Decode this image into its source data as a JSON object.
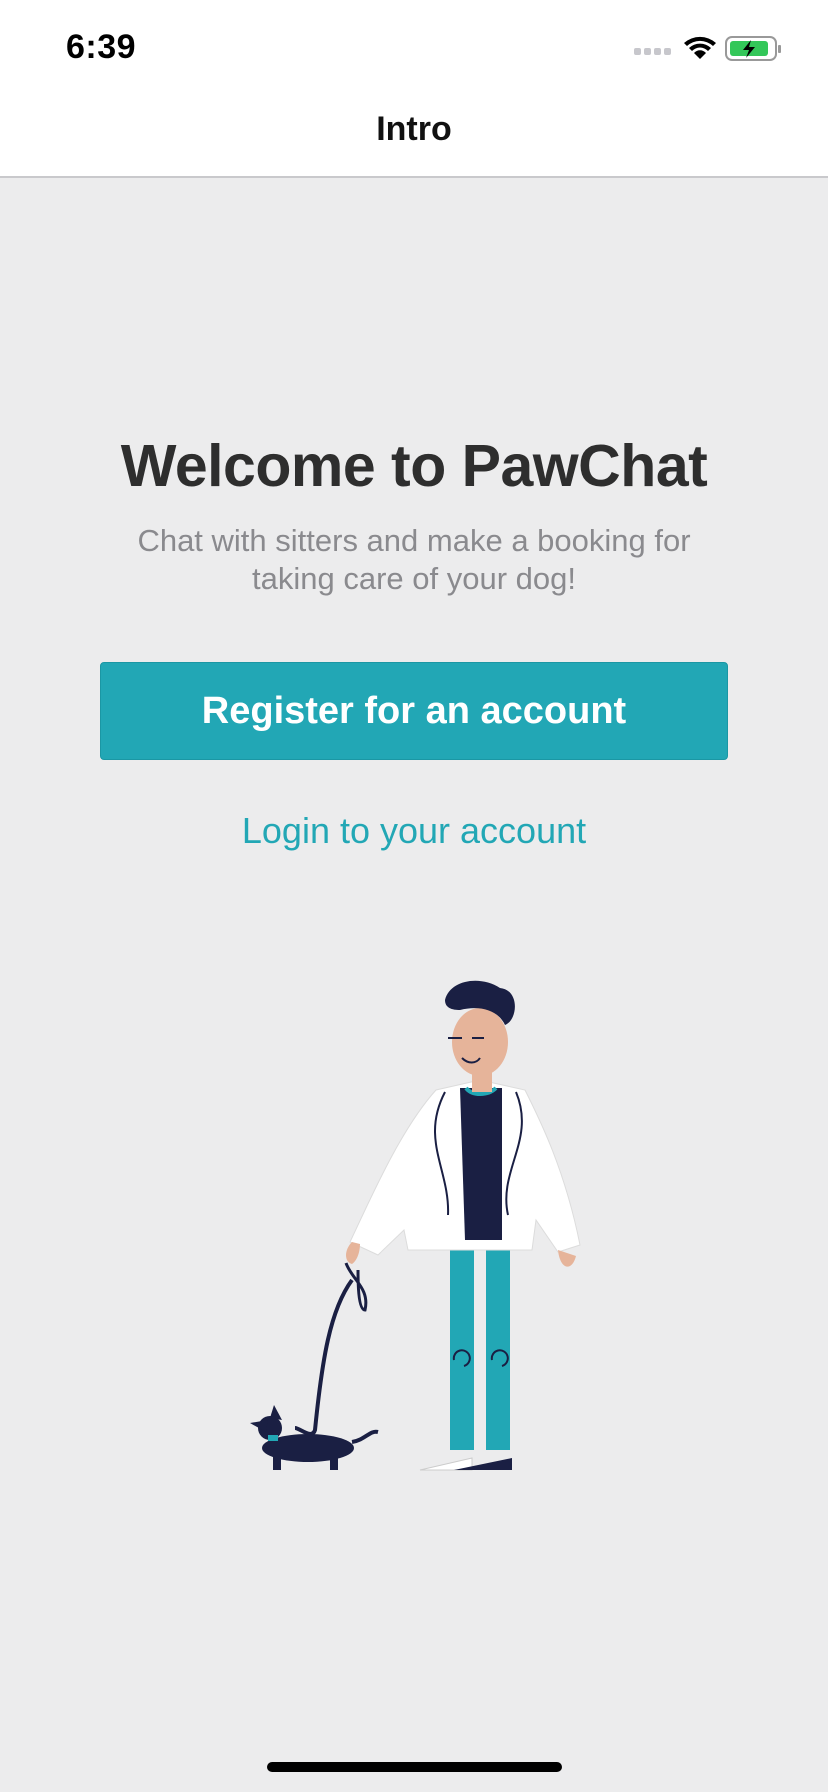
{
  "status_bar": {
    "time": "6:39",
    "icons": [
      "signal-icon",
      "wifi-icon",
      "battery-charging-icon"
    ]
  },
  "nav": {
    "title": "Intro"
  },
  "main": {
    "title": "Welcome to PawChat",
    "subtitle": "Chat with sitters and make a booking for taking care of your dog!",
    "register_label": "Register for an account",
    "login_label": "Login to your account"
  },
  "colors": {
    "accent": "#22a7b5",
    "background": "#ececed",
    "title_text": "#2e2e2e",
    "subtitle_text": "#8a8a8e"
  }
}
